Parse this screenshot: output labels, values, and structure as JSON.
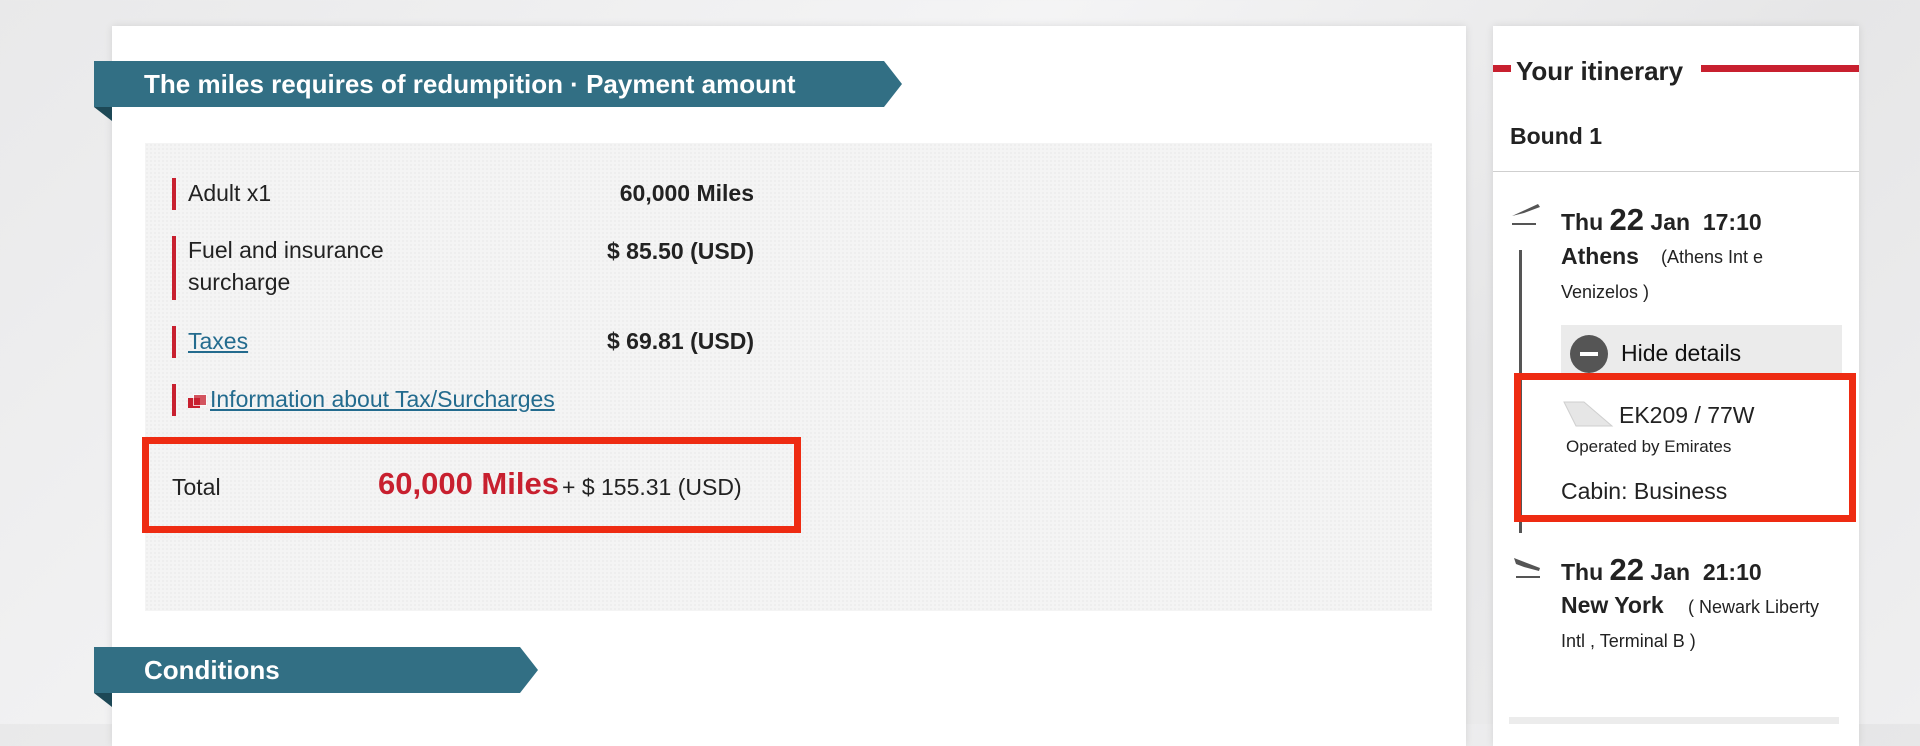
{
  "payment": {
    "heading": "The miles requires of redumpition · Payment amount",
    "items": [
      {
        "label": "Adult x1",
        "value": "60,000 Miles"
      },
      {
        "label": "Fuel and insurance surcharge",
        "value": "$ 85.50 (USD)"
      },
      {
        "label": "Taxes",
        "value": "$ 69.81 (USD)"
      },
      {
        "label": "Information about Tax/Surcharges"
      }
    ],
    "total": {
      "label": "Total",
      "miles": "60,000 Miles",
      "cash": "+ $ 155.31 (USD)"
    }
  },
  "conditions": {
    "heading": "Conditions"
  },
  "itinerary": {
    "title": "Your itinerary",
    "bound": "Bound 1",
    "departure": {
      "day": "Thu",
      "date": "22",
      "month": "Jan",
      "time": "17:10",
      "city": "Athens",
      "airport_line1": "(Athens Int e",
      "airport_line2": "Venizelos )"
    },
    "details_toggle": "Hide details",
    "flight": {
      "number": "EK209  /  77W",
      "operated_by": "Operated by Emirates",
      "cabin": "Cabin: Business"
    },
    "arrival": {
      "day": "Thu",
      "date": "22",
      "month": "Jan",
      "time": "21:10",
      "city": "New York",
      "airport_line1": "( Newark Liberty",
      "airport_line2": "Intl ,  Terminal B )"
    }
  },
  "colors": {
    "ribbon": "#326f84",
    "accent_red": "#c8202f",
    "highlight_box": "#ee2b12",
    "link": "#236b8e"
  },
  "icons": [
    "info-windows-icon",
    "departure-plane-icon",
    "arrival-plane-icon",
    "minus-circle-icon",
    "airline-tail-icon"
  ]
}
